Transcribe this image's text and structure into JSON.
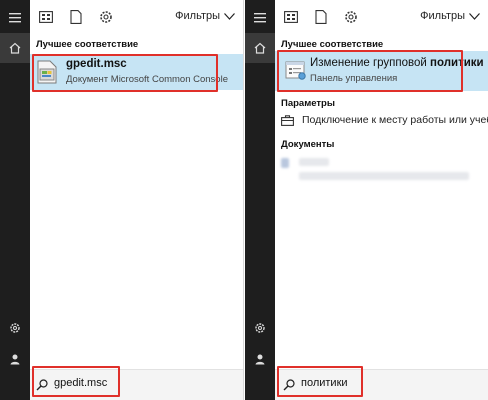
{
  "left_panel": {
    "filters_label": "Фильтры",
    "best_match_header": "Лучшее соответствие",
    "best_match": {
      "title": "gpedit.msc",
      "subtitle": "Документ Microsoft Common Console"
    },
    "search_query": "gpedit.msc"
  },
  "right_panel": {
    "filters_label": "Фильтры",
    "best_match_header": "Лучшее соответствие",
    "best_match": {
      "title_normal": "Изменение групповой ",
      "title_bold": "политики",
      "subtitle": "Панель управления"
    },
    "settings_header": "Параметры",
    "settings_item": "Подключение к месту работы или учебы",
    "documents_header": "Документы",
    "search_query": "политики"
  },
  "colors": {
    "rail": "#1e1e1e",
    "highlight": "#c6e4f4",
    "annotation_red": "#e0302a"
  },
  "icons": [
    "hamburger-icon",
    "home-icon",
    "settings-gear-icon",
    "user-icon",
    "apps-icon",
    "document-icon",
    "gear-icon",
    "chevron-down-icon",
    "search-icon",
    "briefcase-icon"
  ]
}
